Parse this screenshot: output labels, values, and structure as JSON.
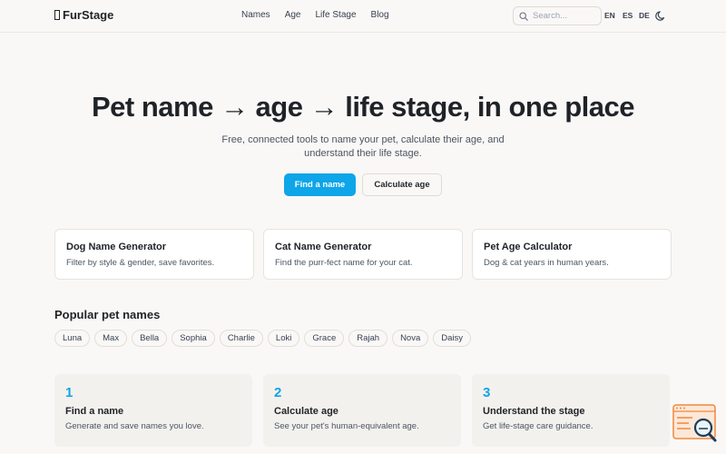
{
  "brand": {
    "name": "FurStage"
  },
  "nav": {
    "items": [
      "Names",
      "Age",
      "Life Stage",
      "Blog"
    ]
  },
  "search": {
    "placeholder": "Search..."
  },
  "languages": [
    "EN",
    "ES",
    "DE"
  ],
  "hero": {
    "title": "Pet name → age → life stage, in one place",
    "subtitle": "Free, connected tools to name your pet, calculate their age, and understand their life stage.",
    "primary_cta": "Find a name",
    "secondary_cta": "Calculate age"
  },
  "tools": [
    {
      "title": "Dog Name Generator",
      "desc": "Filter by style & gender, save favorites."
    },
    {
      "title": "Cat Name Generator",
      "desc": "Find the purr-fect name for your cat."
    },
    {
      "title": "Pet Age Calculator",
      "desc": "Dog & cat years in human years."
    }
  ],
  "popular": {
    "title": "Popular pet names",
    "names": [
      "Luna",
      "Max",
      "Bella",
      "Sophia",
      "Charlie",
      "Loki",
      "Grace",
      "Rajah",
      "Nova",
      "Daisy"
    ]
  },
  "steps": [
    {
      "num": "1",
      "title": "Find a name",
      "desc": "Generate and save names you love."
    },
    {
      "num": "2",
      "title": "Calculate age",
      "desc": "See your pet's human-equivalent age."
    },
    {
      "num": "3",
      "title": "Understand the stage",
      "desc": "Get life-stage care guidance."
    }
  ],
  "colors": {
    "accent": "#0ea5e9",
    "background": "#faf8f6"
  },
  "icons": {
    "search": "search-icon",
    "theme": "moon-icon",
    "brand": "brand-box-icon",
    "widget": "help-search-widget-icon"
  }
}
